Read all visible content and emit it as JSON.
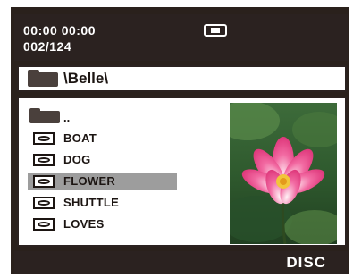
{
  "status": {
    "time": "00:00  00:00",
    "track_count": "002/124",
    "media_icon": "disc-icon"
  },
  "path": {
    "folder_icon": "folder-icon",
    "text": "\\Belle\\"
  },
  "browser": {
    "parent_label": "..",
    "items": [
      {
        "label": "BOAT",
        "icon": "image-file-icon"
      },
      {
        "label": "DOG",
        "icon": "image-file-icon"
      },
      {
        "label": "FLOWER",
        "icon": "image-file-icon",
        "selected": true
      },
      {
        "label": "SHUTTLE",
        "icon": "image-file-icon"
      },
      {
        "label": "LOVES",
        "icon": "image-file-icon"
      }
    ],
    "selected_index": 2
  },
  "preview": {
    "subject": "pink lotus flower"
  },
  "bottom": {
    "source_label": "DISC"
  },
  "colors": {
    "bar": "#2b2220",
    "selection": "#9d9d9d",
    "text_dark": "#1c1512"
  }
}
